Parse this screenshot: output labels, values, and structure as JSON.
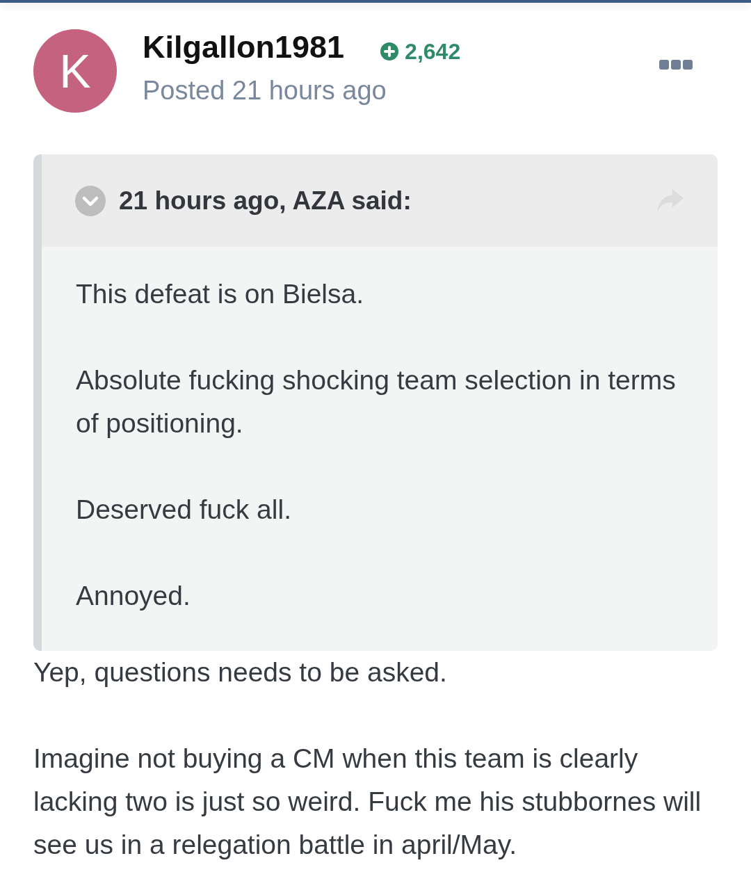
{
  "post": {
    "avatar_initial": "K",
    "author": "Kilgallon1981",
    "reputation": "2,642",
    "posted": "Posted 21 hours ago"
  },
  "quote": {
    "citation": "21 hours ago, AZA said:",
    "paragraphs": [
      "This defeat is on Bielsa.",
      "Absolute fucking shocking team selection in terms of positioning.",
      "Deserved fuck all.",
      "Annoyed."
    ]
  },
  "content": {
    "paragraphs": [
      "Yep, questions needs to be asked.",
      "Imagine not buying a CM when this team is clearly lacking two is just so weird. Fuck me his stubbornes will see us in a relegation battle in april/May."
    ]
  }
}
